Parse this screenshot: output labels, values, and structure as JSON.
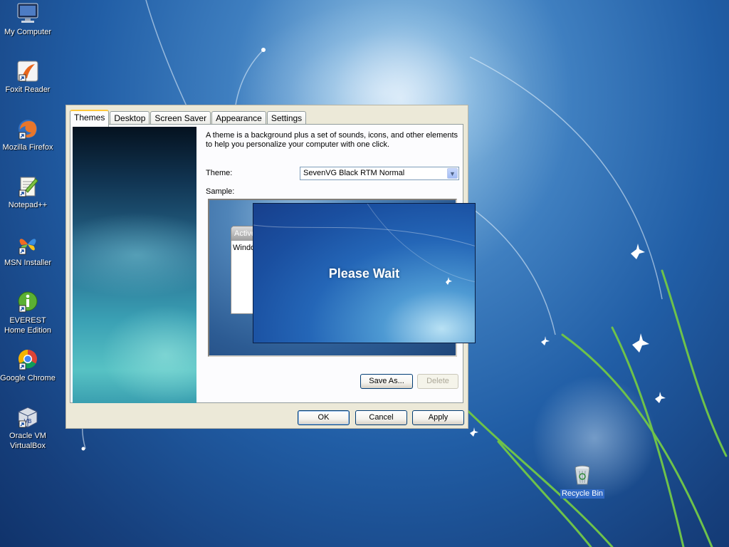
{
  "desktop": {
    "icons": [
      {
        "label": "My Computer"
      },
      {
        "label": "Foxit Reader"
      },
      {
        "label": "Mozilla Firefox"
      },
      {
        "label": "Notepad++"
      },
      {
        "label": "MSN Installer"
      },
      {
        "label": "EVEREST Home Edition"
      },
      {
        "label": "Google Chrome"
      },
      {
        "label": "Oracle VM VirtualBox"
      },
      {
        "label": "Recycle Bin"
      }
    ]
  },
  "dialog": {
    "tabs": [
      "Themes",
      "Desktop",
      "Screen Saver",
      "Appearance",
      "Settings"
    ],
    "active_tab": "Themes",
    "description": "A theme is a background plus a set of sounds, icons, and other elements to help you personalize your computer with one click.",
    "theme_label": "Theme:",
    "theme_value": "SevenVG Black RTM Normal",
    "sample_label": "Sample:",
    "sample_window": {
      "title": "Active",
      "body": "Window"
    },
    "buttons": {
      "save_as": "Save As...",
      "delete": "Delete",
      "ok": "OK",
      "cancel": "Cancel",
      "apply": "Apply"
    }
  },
  "splash": {
    "message": "Please Wait"
  },
  "colors": {
    "selection": "#316ac5",
    "tab_highlight": "#ffc83c",
    "dialog_face": "#ece9d8"
  }
}
